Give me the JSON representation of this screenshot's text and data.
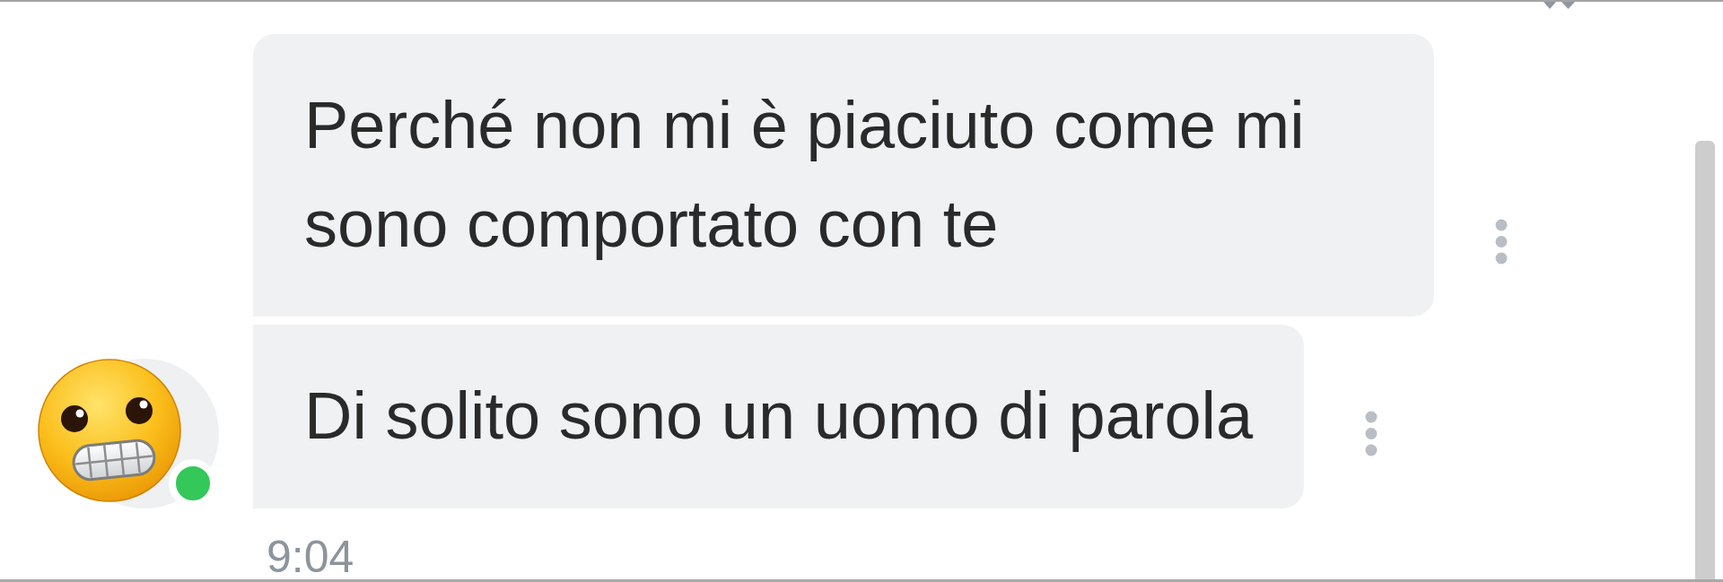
{
  "thread": {
    "messages": [
      {
        "text": "Perché non mi è piaciuto come mi sono comportato con te"
      },
      {
        "text": "Di solito sono un uomo di parola"
      }
    ],
    "sender": {
      "online": true
    },
    "time": "9:04"
  }
}
